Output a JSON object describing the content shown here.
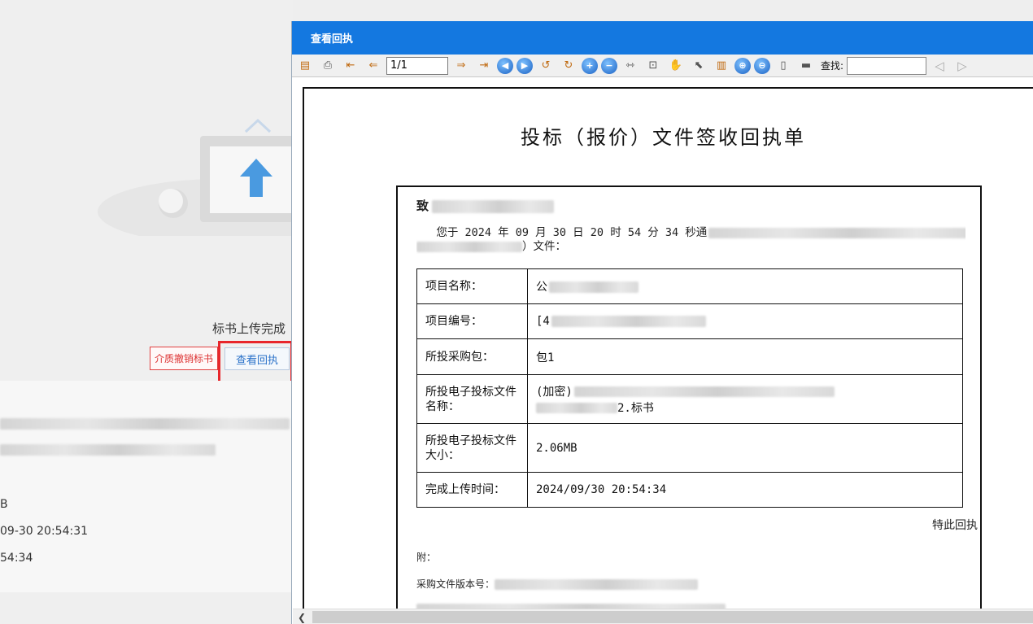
{
  "background": {
    "upload_status": "标书上传完成",
    "revoke_button": "介质撤销标书",
    "receipt_button": "查看回执",
    "info_lines": [
      "B",
      "09-30 20:54:31",
      "54:34"
    ]
  },
  "dialog": {
    "title": "查看回执",
    "toolbar": {
      "page_value": "1/1",
      "find_label": "查找:"
    },
    "document": {
      "title": "投标（报价）文件签收回执单",
      "to_prefix": "致",
      "intro_line1": "您于 2024 年 09 月 30 日 20 时 54 分 34 秒通",
      "intro_line2_end": "）文件：",
      "rows": [
        {
          "label": "项目名称：",
          "value": "公"
        },
        {
          "label": "项目编号：",
          "value": "[4"
        },
        {
          "label": "所投采购包：",
          "value": "包1"
        },
        {
          "label": "所投电子投标文件名称：",
          "value": "(加密)",
          "value_tail": "2.标书"
        },
        {
          "label": "所投电子投标文件大小：",
          "value": "2.06MB"
        },
        {
          "label": "完成上传时间：",
          "value": "2024/09/30 20:54:34"
        }
      ],
      "sign_off": "特此回执",
      "attachment_label": "附：",
      "version_label": "采购文件版本号："
    }
  },
  "colors": {
    "titlebar": "#1478e0",
    "highlight": "#e8262b",
    "link_blue": "#2a72c9"
  }
}
